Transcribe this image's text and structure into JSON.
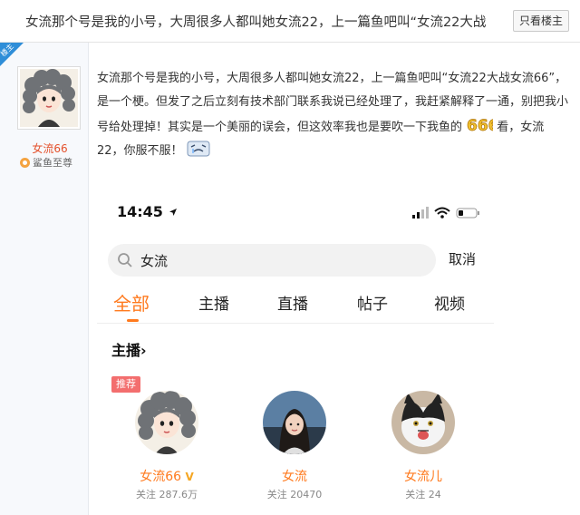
{
  "thread": {
    "title": "女流那个号是我的小号，大周很多人都叫她女流22，上一篇鱼吧叫“女流22大战",
    "only_op_label": "只看楼主"
  },
  "author": {
    "op_tag": "楼主",
    "name": "女流66",
    "badge": "鲨鱼至尊"
  },
  "post": {
    "text_part1": "女流那个号是我的小号，大周很多人都叫她女流22，上一篇鱼吧叫“女流22大战女流66”，是一个梗。但发了之后立刻有技术部门联系我说已经处理了，我赶紧解释了一通，别把我小号给处理掉！其实是一个美丽的误会，但这效率我也是要吹一下我鱼的",
    "emoji_666_label": "666",
    "text_part2": "看，女流22，你服不服！"
  },
  "phone": {
    "status_time": "14:45",
    "search_query": "女流",
    "cancel_label": "取消",
    "tabs": [
      "全部",
      "主播",
      "直播",
      "帖子",
      "视频"
    ],
    "active_tab": "全部",
    "section_title": "主播",
    "section_arrow": "›",
    "recommend_tag": "推荐",
    "anchors": [
      {
        "name": "女流66",
        "verified_mark": "V",
        "followers": "关注 287.6万"
      },
      {
        "name": "女流",
        "followers": "关注 20470"
      },
      {
        "name": "女流儿",
        "followers": "关注 24"
      }
    ]
  },
  "colors": {
    "accent_orange": "#ff7a1e",
    "author_name": "#e4512c",
    "op_ribbon": "#2f8ed8",
    "recommend_tag": "#f36e6e"
  }
}
